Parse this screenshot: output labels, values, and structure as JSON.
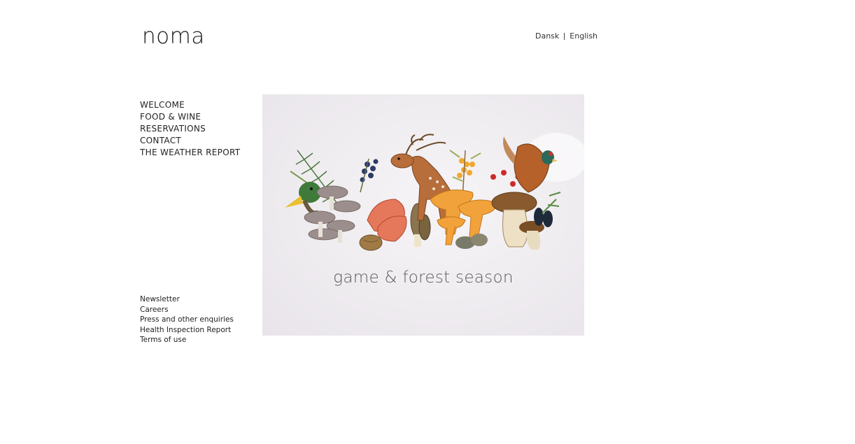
{
  "header": {
    "logo_text": "noma",
    "languages": [
      "Dansk",
      "English"
    ]
  },
  "main_nav": {
    "items": [
      "WELCOME",
      "FOOD & WINE",
      "RESERVATIONS",
      "CONTACT",
      "THE WEATHER REPORT"
    ]
  },
  "footer_nav": {
    "items": [
      "Newsletter",
      "Careers",
      "Press and other enquiries",
      "Health Inspection Report",
      "Terms of use"
    ]
  },
  "hero": {
    "caption": "game & forest season",
    "illustration": "watercolor-forest-illustration"
  }
}
